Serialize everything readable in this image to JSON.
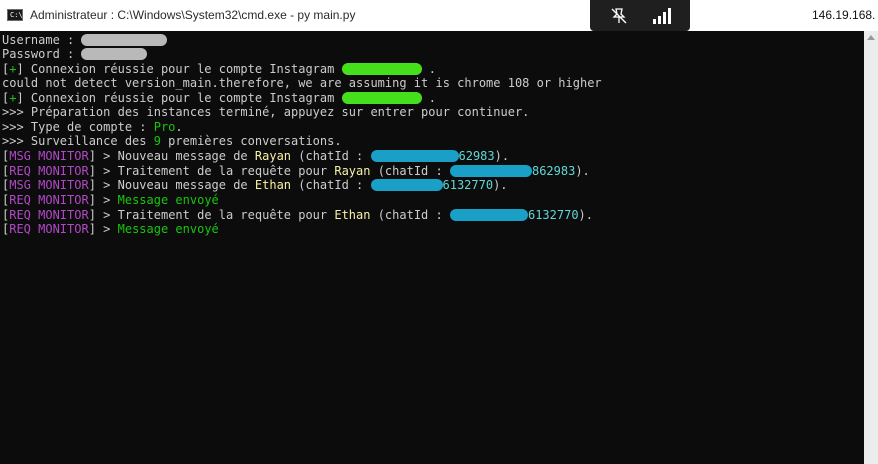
{
  "window": {
    "title": "Administrateur : C:\\Windows\\System32\\cmd.exe - py  main.py",
    "icon_text": "C:\\.",
    "remote_ip": "146.19.168."
  },
  "console": {
    "lines": [
      {
        "parts": [
          {
            "t": "Username : ",
            "c": "w"
          },
          {
            "blur": "grey",
            "w": 86
          }
        ]
      },
      {
        "parts": [
          {
            "t": "Password : ",
            "c": "w"
          },
          {
            "blur": "grey",
            "w": 66
          }
        ]
      },
      {
        "parts": [
          {
            "t": "[",
            "c": "w"
          },
          {
            "t": "+",
            "c": "g"
          },
          {
            "t": "] Connexion réussie pour le compte Instagram ",
            "c": "w"
          },
          {
            "blur": "green",
            "w": 80
          },
          {
            "t": " .",
            "c": "w"
          }
        ]
      },
      {
        "parts": [
          {
            "t": "could not detect version_main.therefore, we are assuming it is chrome 108 or higher",
            "c": "w"
          }
        ]
      },
      {
        "parts": [
          {
            "t": "[",
            "c": "w"
          },
          {
            "t": "+",
            "c": "g"
          },
          {
            "t": "] Connexion réussie pour le compte Instagram ",
            "c": "w"
          },
          {
            "blur": "green",
            "w": 80
          },
          {
            "t": " .",
            "c": "w"
          }
        ]
      },
      {
        "parts": [
          {
            "t": ">>> Préparation des instances terminé, appuyez sur entrer pour continuer.",
            "c": "w"
          }
        ]
      },
      {
        "parts": [
          {
            "t": ">>> Type de compte : ",
            "c": "w"
          },
          {
            "t": "Pro",
            "c": "g"
          },
          {
            "t": ".",
            "c": "w"
          }
        ]
      },
      {
        "parts": [
          {
            "t": ">>> Surveillance des ",
            "c": "w"
          },
          {
            "t": "9",
            "c": "g"
          },
          {
            "t": " premières conversations.",
            "c": "w"
          }
        ]
      },
      {
        "parts": [
          {
            "t": "[",
            "c": "w"
          },
          {
            "t": "MSG MONITOR",
            "c": "m"
          },
          {
            "t": "] > Nouveau message de ",
            "c": "w"
          },
          {
            "t": "Rayan",
            "c": "y"
          },
          {
            "t": " (chatId : ",
            "c": "w"
          },
          {
            "blur": "blue",
            "w": 88
          },
          {
            "t": "62983",
            "c": "c"
          },
          {
            "t": ").",
            "c": "w"
          }
        ]
      },
      {
        "parts": [
          {
            "t": "[",
            "c": "w"
          },
          {
            "t": "REQ MONITOR",
            "c": "m"
          },
          {
            "t": "] > Traitement de la requête pour ",
            "c": "w"
          },
          {
            "t": "Rayan",
            "c": "y"
          },
          {
            "t": " (chatId : ",
            "c": "w"
          },
          {
            "blur": "blue",
            "w": 82
          },
          {
            "t": "862983",
            "c": "c"
          },
          {
            "t": ").",
            "c": "w"
          }
        ]
      },
      {
        "parts": [
          {
            "t": "[",
            "c": "w"
          },
          {
            "t": "MSG MONITOR",
            "c": "m"
          },
          {
            "t": "] > Nouveau message de ",
            "c": "w"
          },
          {
            "t": "Ethan",
            "c": "y"
          },
          {
            "t": " (chatId : ",
            "c": "w"
          },
          {
            "blur": "blue",
            "w": 72
          },
          {
            "t": "6132770",
            "c": "c"
          },
          {
            "t": ").",
            "c": "w"
          }
        ]
      },
      {
        "parts": [
          {
            "t": "[",
            "c": "w"
          },
          {
            "t": "REQ MONITOR",
            "c": "m"
          },
          {
            "t": "] > ",
            "c": "w"
          },
          {
            "t": "Message envoyé",
            "c": "g"
          }
        ]
      },
      {
        "parts": [
          {
            "t": "[",
            "c": "w"
          },
          {
            "t": "REQ MONITOR",
            "c": "m"
          },
          {
            "t": "] > Traitement de la requête pour ",
            "c": "w"
          },
          {
            "t": "Ethan",
            "c": "y"
          },
          {
            "t": " (chatId : ",
            "c": "w"
          },
          {
            "blur": "blue",
            "w": 78
          },
          {
            "t": "6132770",
            "c": "c"
          },
          {
            "t": ").",
            "c": "w"
          }
        ]
      },
      {
        "parts": [
          {
            "t": "[",
            "c": "w"
          },
          {
            "t": "REQ MONITOR",
            "c": "m"
          },
          {
            "t": "] > ",
            "c": "w"
          },
          {
            "t": "Message envoyé",
            "c": "g"
          }
        ]
      }
    ]
  },
  "icons": {
    "rdp_pin": "pin-off-icon",
    "rdp_signal": "signal-bars-icon",
    "app": "cmd-icon"
  },
  "colors": {
    "console_bg": "#0c0c0c",
    "text": "#cccccc",
    "green": "#16c60c",
    "magenta": "#b148c6",
    "yellow": "#f9f1a5",
    "cyan": "#61d6d6"
  }
}
